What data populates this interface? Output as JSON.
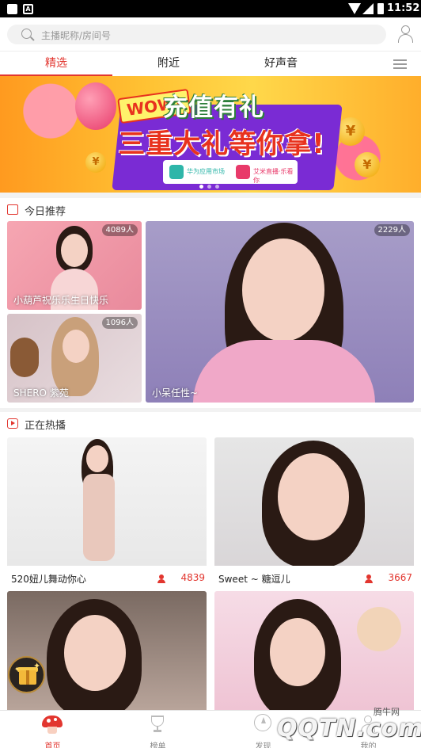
{
  "status_bar": {
    "time": "11:52"
  },
  "search": {
    "placeholder": "主播昵称/房间号"
  },
  "tabs": [
    {
      "label": "精选",
      "active": true
    },
    {
      "label": "附近",
      "active": false
    },
    {
      "label": "好声音",
      "active": false
    }
  ],
  "banner": {
    "badge": "WOW!",
    "headline": "充值有礼",
    "subline": "三重大礼等你拿!",
    "partner_1": "华为应用市场",
    "partner_2": "艾米直播·乐看你"
  },
  "today_recommend": {
    "title": "今日推荐",
    "items": [
      {
        "caption": "小葫芦祝乐乐生日快乐",
        "viewers": "4089人"
      },
      {
        "caption": "SHERO 紫苑",
        "viewers": "1096人"
      },
      {
        "caption": "小呆任性~",
        "viewers": "2229人"
      }
    ]
  },
  "live_now": {
    "title": "正在热播",
    "items": [
      {
        "name": "520妞儿舞动你心",
        "viewers": "4839"
      },
      {
        "name": "Sweet ~ 糖逗儿",
        "viewers": "3667"
      }
    ]
  },
  "bottom_nav": [
    {
      "label": "首页",
      "active": true
    },
    {
      "label": "榜单",
      "active": false
    },
    {
      "label": "发现",
      "active": false
    },
    {
      "label": "我的",
      "active": false
    }
  ],
  "watermark": {
    "text": "QQTN.com",
    "sub": "腾牛网"
  },
  "colors": {
    "accent": "#e2362f",
    "background": "#f2f2f2"
  }
}
